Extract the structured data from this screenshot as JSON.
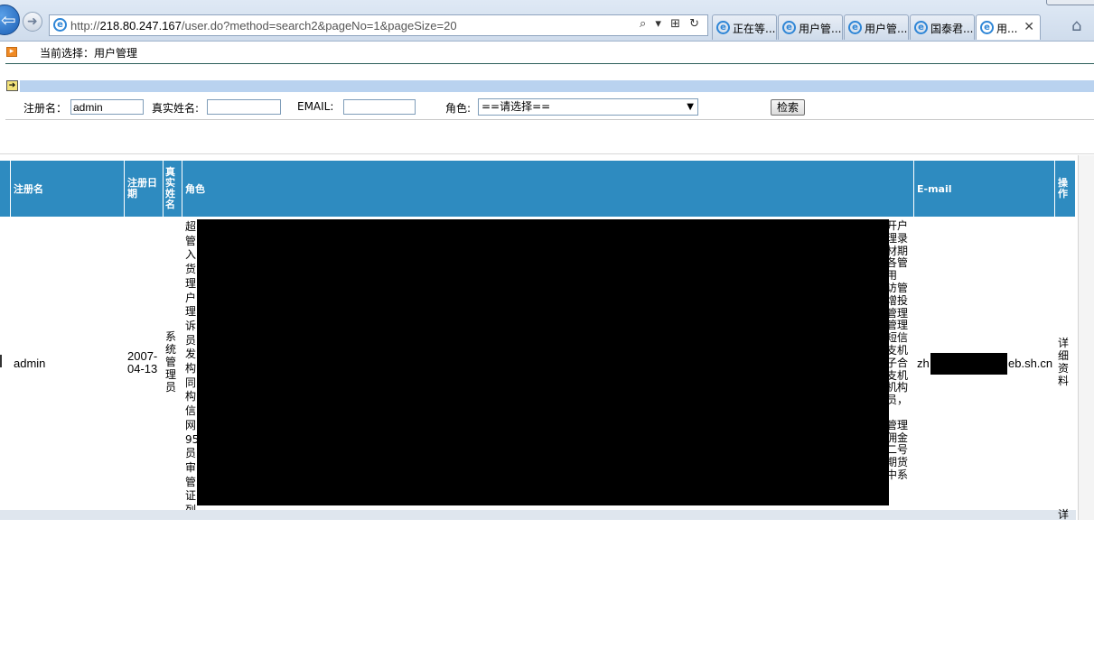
{
  "browser": {
    "url_prefix": "http://",
    "url_host": "218.80.247.167",
    "url_rest": "/user.do?method=search2&pageNo=1&pageSize=20",
    "address_tools": "⌕ ▾ ⊞ ↻",
    "tabs": [
      {
        "label": "正在等...",
        "active": false
      },
      {
        "label": "用户管...",
        "active": false
      },
      {
        "label": "用户管...",
        "active": false
      },
      {
        "label": "国泰君...",
        "active": false
      },
      {
        "label": "用...",
        "active": true
      }
    ],
    "close_glyph": "✕",
    "home_glyph": "⌂"
  },
  "page": {
    "breadcrumb": "当前选择：用户管理"
  },
  "search": {
    "login_label": "注册名：",
    "login_value": "admin",
    "realname_label": "真实姓名:",
    "realname_value": "",
    "email_label": "EMAIL:",
    "email_value": "",
    "role_label": "角色:",
    "role_selected": "==请选择==",
    "submit_label": "检索"
  },
  "table": {
    "headers": {
      "login": "注册名",
      "date": "注册日期",
      "realname": "真实姓名",
      "role": "角色",
      "email": "E-mail",
      "action": "操作"
    },
    "rows": [
      {
        "login": "admin",
        "date_line1": "2007-",
        "date_line2": "04-13",
        "realname": "系统管理员",
        "role_left": "超管入货理户理诉员发构同构信网95员审管证列",
        "role_right_lines": [
          "开户",
          "理录",
          "材期",
          "各管",
          "用",
          "访管",
          "增投",
          "管理",
          "管理",
          "短信",
          "支机",
          "子合",
          "支机",
          "机构",
          "员，",
          "",
          "管理",
          "佣金",
          "二号",
          "期货",
          "中系"
        ],
        "email_prefix": "zh",
        "email_suffix": "eb.sh.cn",
        "action": "详细资料"
      }
    ],
    "row2_action": "详"
  }
}
